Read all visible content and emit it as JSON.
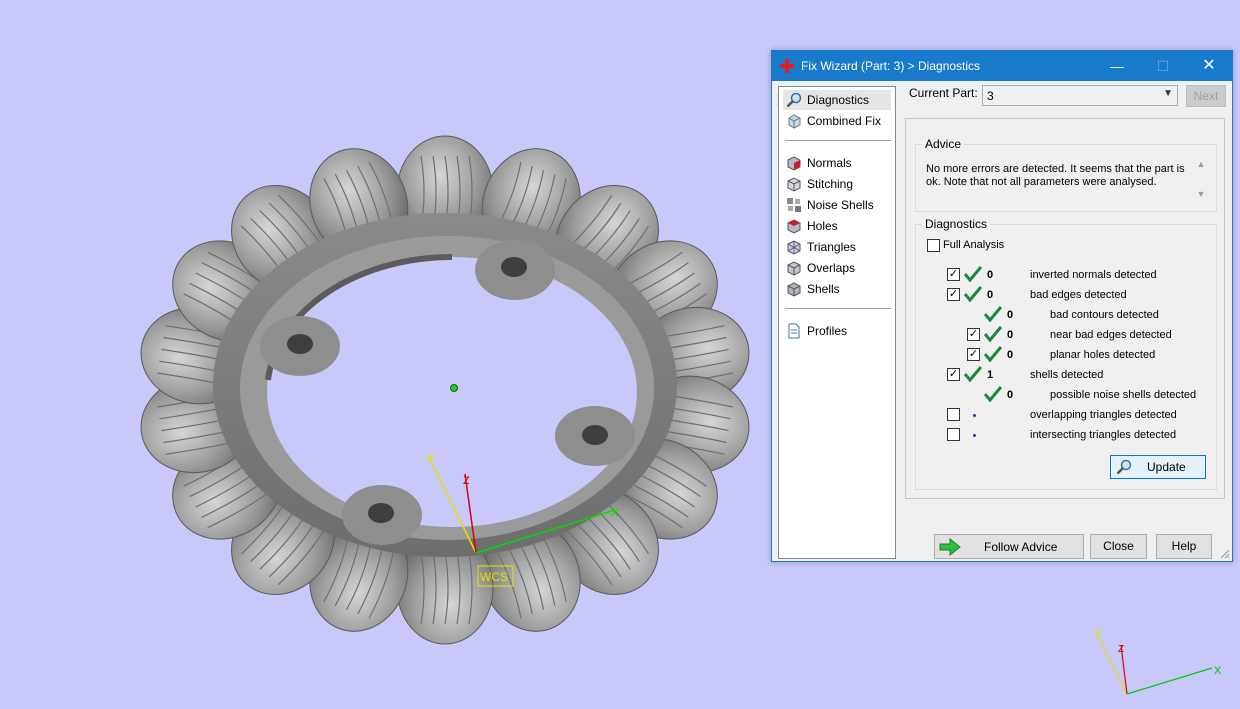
{
  "viewport": {
    "wcs_label": "WCS",
    "axis_labels": {
      "x": "X",
      "y": "Y",
      "z": "Z"
    }
  },
  "dialog": {
    "title": "Fix Wizard (Part: 3) > Diagnostics",
    "window_buttons": {
      "minimize": "—",
      "maximize": "☐",
      "close": "✕"
    },
    "nav": {
      "items": [
        {
          "label": "Diagnostics",
          "icon": "magnifier-icon"
        },
        {
          "label": "Combined Fix",
          "icon": "combined-fix-icon"
        },
        {
          "label": "Normals",
          "icon": "normals-icon"
        },
        {
          "label": "Stitching",
          "icon": "stitching-icon"
        },
        {
          "label": "Noise Shells",
          "icon": "noise-shells-icon"
        },
        {
          "label": "Holes",
          "icon": "holes-icon"
        },
        {
          "label": "Triangles",
          "icon": "triangles-icon"
        },
        {
          "label": "Overlaps",
          "icon": "overlaps-icon"
        },
        {
          "label": "Shells",
          "icon": "shells-icon"
        },
        {
          "label": "Profiles",
          "icon": "profiles-icon"
        }
      ]
    },
    "current_part_label": "Current Part:",
    "current_part_value": "3",
    "next_label": "Next",
    "advice": {
      "title": "Advice",
      "text": "No more errors are detected. It seems that the part is ok. Note that not all parameters were analysed."
    },
    "diagnostics": {
      "title": "Diagnostics",
      "full_analysis_label": "Full Analysis",
      "rows": [
        {
          "checkbox": true,
          "status": "ok",
          "value": "0",
          "label": "inverted normals detected"
        },
        {
          "checkbox": true,
          "status": "ok",
          "value": "0",
          "label": "bad edges detected"
        },
        {
          "checkbox": false,
          "status": "ok",
          "value": "0",
          "label": "bad contours detected"
        },
        {
          "checkbox": true,
          "status": "ok",
          "value": "0",
          "label": "near bad edges detected"
        },
        {
          "checkbox": true,
          "status": "ok",
          "value": "0",
          "label": "planar holes detected"
        },
        {
          "checkbox": true,
          "status": "ok",
          "value": "1",
          "label": "shells detected"
        },
        {
          "checkbox": false,
          "status": "ok",
          "value": "0",
          "label": "possible noise shells detected"
        },
        {
          "checkbox": true,
          "status": "pending",
          "value": "",
          "label": "overlapping triangles detected"
        },
        {
          "checkbox": true,
          "status": "pending",
          "value": "",
          "label": "intersecting triangles detected"
        }
      ],
      "update_label": "Update"
    },
    "footer": {
      "follow_advice_label": "Follow Advice",
      "close_label": "Close",
      "help_label": "Help"
    }
  }
}
